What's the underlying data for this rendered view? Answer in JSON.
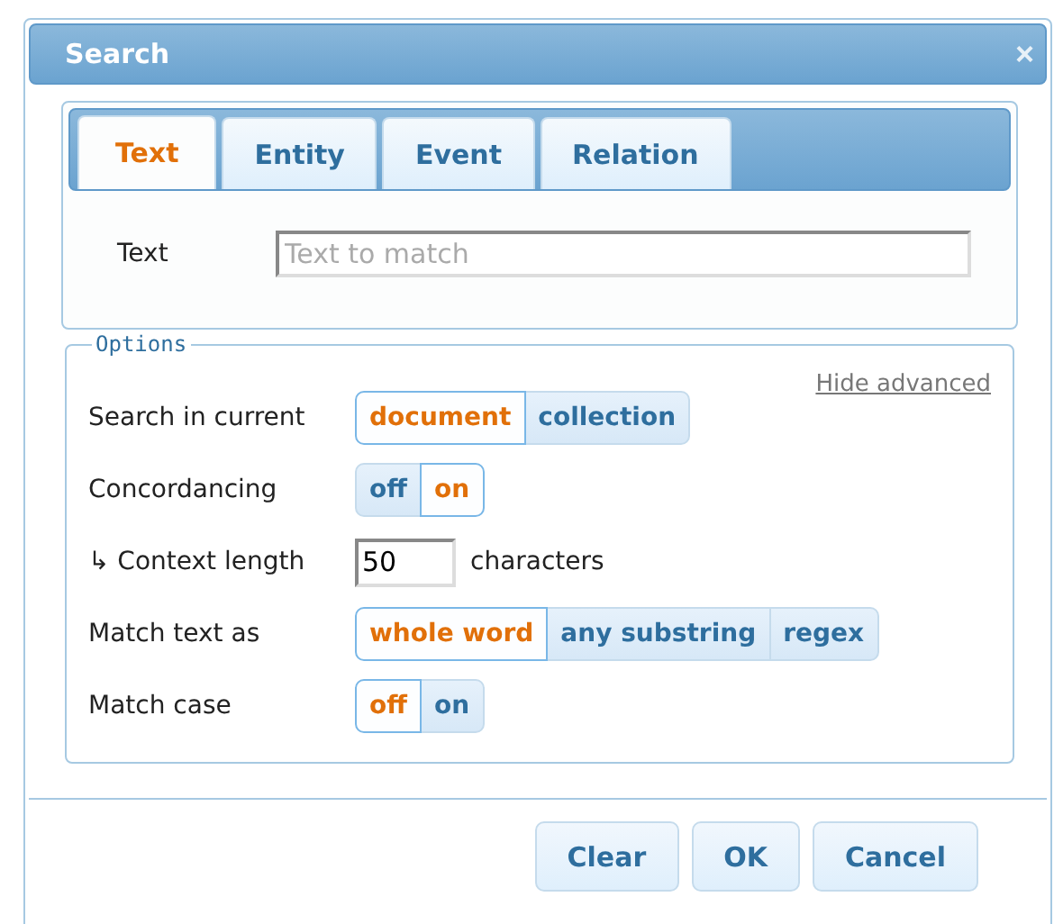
{
  "window": {
    "title": "Search",
    "close": "×"
  },
  "tabs": [
    {
      "label": "Text",
      "selected": true
    },
    {
      "label": "Entity",
      "selected": false
    },
    {
      "label": "Event",
      "selected": false
    },
    {
      "label": "Relation",
      "selected": false
    }
  ],
  "text_field": {
    "label": "Text",
    "placeholder": "Text to match"
  },
  "options": {
    "legend": "Options",
    "hide_link": "Hide advanced",
    "rows": [
      {
        "kind": "toggle",
        "label": "Search in current",
        "choices": [
          {
            "label": "document",
            "selected": true
          },
          {
            "label": "collection",
            "selected": false
          }
        ]
      },
      {
        "kind": "toggle",
        "label": "Concordancing",
        "choices": [
          {
            "label": "off",
            "selected": false
          },
          {
            "label": "on",
            "selected": true
          }
        ]
      },
      {
        "kind": "number",
        "label": "↳ Context length",
        "value": "50",
        "suffix": "characters"
      },
      {
        "kind": "toggle",
        "label": "Match text as",
        "choices": [
          {
            "label": "whole word",
            "selected": true
          },
          {
            "label": "any substring",
            "selected": false
          },
          {
            "label": "regex",
            "selected": false
          }
        ]
      },
      {
        "kind": "toggle",
        "label": "Match case",
        "choices": [
          {
            "label": "off",
            "selected": true
          },
          {
            "label": "on",
            "selected": false
          }
        ]
      }
    ]
  },
  "buttons": [
    "Clear",
    "OK",
    "Cancel"
  ]
}
